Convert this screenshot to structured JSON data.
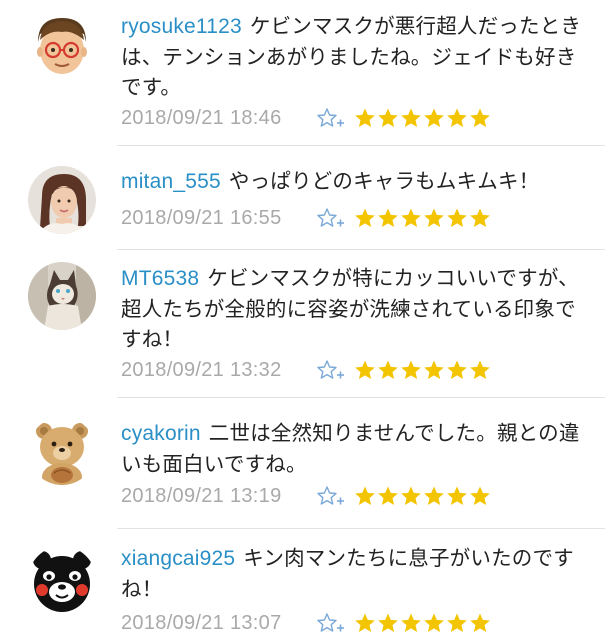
{
  "comments": [
    {
      "username": "ryosuke1123",
      "text": "ケビンマスクが悪行超人だったときは、テンションあがりましたね。ジェイドも好きです。",
      "timestamp": "2018/09/21 18:46",
      "rating": 6,
      "avatar_icon": "cartoon-man-glasses-avatar"
    },
    {
      "username": "mitan_555",
      "text": "やっぱりどのキャラもムキムキ！",
      "timestamp": "2018/09/21 16:55",
      "rating": 6,
      "avatar_icon": "woman-photo-avatar"
    },
    {
      "username": "MT6538",
      "text": "ケビンマスクが特にカッコいいですが、超人たちが全般的に容姿が洗練されている印象ですね！",
      "timestamp": "2018/09/21 13:32",
      "rating": 6,
      "avatar_icon": "cat-photo-avatar"
    },
    {
      "username": "cyakorin",
      "text": "二世は全然知りませんでした。親との違いも面白いですね。",
      "timestamp": "2018/09/21 13:19",
      "rating": 6,
      "avatar_icon": "teddy-bear-avatar"
    },
    {
      "username": "xiangcai925",
      "text": "キン肉マンたちに息子がいたのですね！",
      "timestamp": "2018/09/21 13:07",
      "rating": 6,
      "avatar_icon": "kumamon-avatar"
    }
  ],
  "colors": {
    "username": "#2a8fc6",
    "star": "#f3c400",
    "timestamp": "#a9a9a9",
    "fav_icon": "#7aa9d8"
  }
}
